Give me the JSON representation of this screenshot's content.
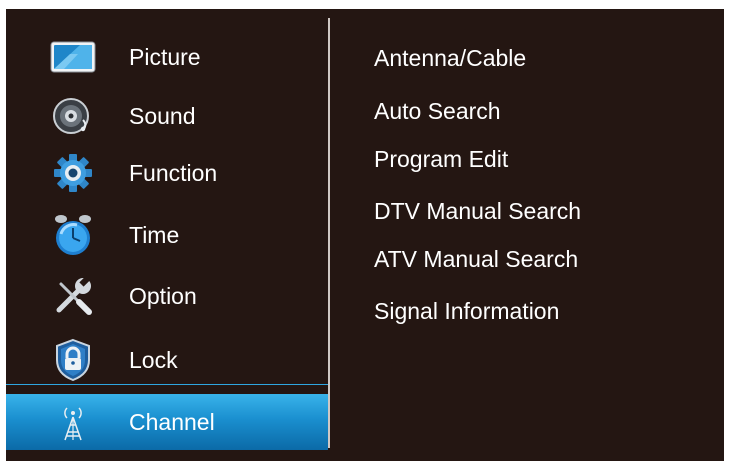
{
  "sidebar": {
    "items": [
      {
        "label": "Picture",
        "icon": "picture-icon"
      },
      {
        "label": "Sound",
        "icon": "speaker-icon"
      },
      {
        "label": "Function",
        "icon": "gear-icon"
      },
      {
        "label": "Time",
        "icon": "clock-icon"
      },
      {
        "label": "Option",
        "icon": "tools-icon"
      },
      {
        "label": "Lock",
        "icon": "lock-icon"
      },
      {
        "label": "Channel",
        "icon": "antenna-icon"
      }
    ],
    "selected": "Channel"
  },
  "submenu": {
    "items": [
      {
        "label": "Antenna/Cable"
      },
      {
        "label": "Auto Search"
      },
      {
        "label": "Program Edit"
      },
      {
        "label": "DTV Manual Search"
      },
      {
        "label": "ATV Manual Search"
      },
      {
        "label": "Signal Information"
      }
    ]
  },
  "colors": {
    "background": "#241612",
    "accent": "#1a8fcf",
    "text": "#ffffff"
  }
}
